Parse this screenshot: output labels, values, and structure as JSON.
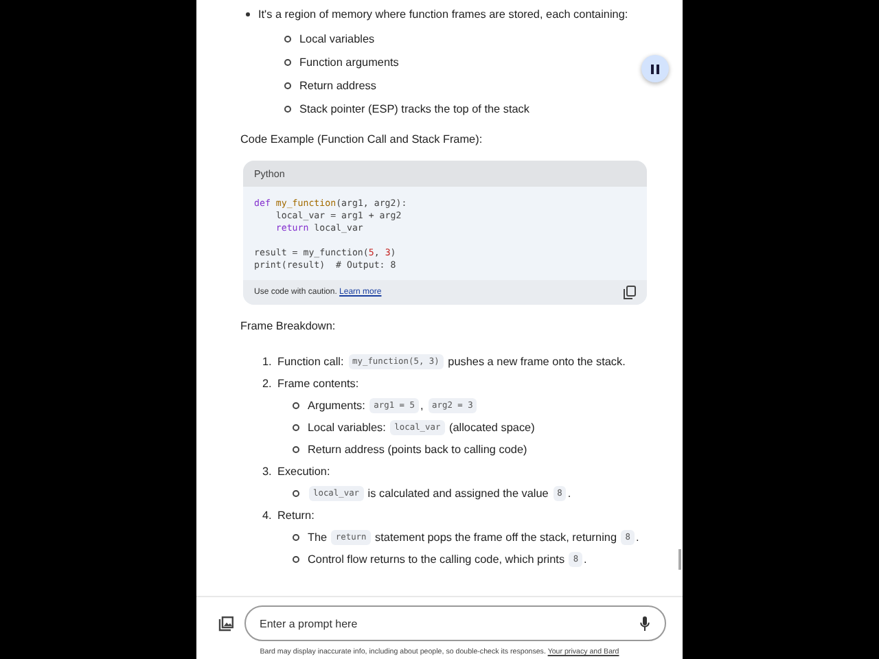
{
  "intro": {
    "text": "It's a region of memory where function frames are stored, each containing:",
    "items": [
      "Local variables",
      "Function arguments",
      "Return address",
      "Stack pointer (ESP) tracks the top of the stack"
    ]
  },
  "code_heading": "Code Example (Function Call and Stack Frame):",
  "code_block": {
    "language": "Python",
    "lines": [
      {
        "kind": "code",
        "tokens": [
          {
            "kind": "keyword",
            "text": "def "
          },
          {
            "kind": "function",
            "text": "my_function"
          },
          {
            "kind": "plain",
            "text": "(arg1, arg2):"
          }
        ]
      },
      {
        "kind": "code",
        "tokens": [
          {
            "kind": "plain",
            "text": "    local_var = arg1 + arg2"
          }
        ]
      },
      {
        "kind": "code",
        "tokens": [
          {
            "kind": "keyword",
            "text": "    return"
          },
          {
            "kind": "plain",
            "text": " local_var"
          }
        ]
      },
      {
        "kind": "blank"
      },
      {
        "kind": "code",
        "tokens": [
          {
            "kind": "plain",
            "text": "result = my_function("
          },
          {
            "kind": "number",
            "text": "5"
          },
          {
            "kind": "plain",
            "text": ", "
          },
          {
            "kind": "number",
            "text": "3"
          },
          {
            "kind": "plain",
            "text": ")"
          }
        ]
      },
      {
        "kind": "code",
        "tokens": [
          {
            "kind": "plain",
            "text": "print(result)  # Output: 8"
          }
        ]
      }
    ],
    "caution": "Use code with caution.",
    "link": "Learn more"
  },
  "breakdown_heading": "Frame Breakdown:",
  "steps": [
    {
      "number": "1.",
      "segments": [
        {
          "kind": "text",
          "text": "Function call: "
        },
        {
          "kind": "code",
          "text": "my_function(5, 3)"
        },
        {
          "kind": "text",
          "text": " pushes a new frame onto the stack."
        }
      ]
    },
    {
      "number": "2.",
      "segments": [
        {
          "kind": "text",
          "text": "Frame contents:"
        }
      ],
      "items": [
        [
          {
            "kind": "text",
            "text": "Arguments: "
          },
          {
            "kind": "code",
            "text": "arg1 = 5"
          },
          {
            "kind": "text",
            "text": ", "
          },
          {
            "kind": "code",
            "text": "arg2 = 3"
          }
        ],
        [
          {
            "kind": "text",
            "text": "Local variables: "
          },
          {
            "kind": "code",
            "text": "local_var"
          },
          {
            "kind": "text",
            "text": " (allocated space)"
          }
        ],
        [
          {
            "kind": "text",
            "text": "Return address (points back to calling code)"
          }
        ]
      ]
    },
    {
      "number": "3.",
      "segments": [
        {
          "kind": "text",
          "text": "Execution:"
        }
      ],
      "items": [
        [
          {
            "kind": "code",
            "text": "local_var"
          },
          {
            "kind": "text",
            "text": " is calculated and assigned the value "
          },
          {
            "kind": "code",
            "text": "8"
          },
          {
            "kind": "text",
            "text": "."
          }
        ]
      ]
    },
    {
      "number": "4.",
      "segments": [
        {
          "kind": "text",
          "text": "Return:"
        }
      ],
      "items": [
        [
          {
            "kind": "text",
            "text": "The "
          },
          {
            "kind": "code",
            "text": "return"
          },
          {
            "kind": "text",
            "text": " statement pops the frame off the stack, returning "
          },
          {
            "kind": "code",
            "text": "8"
          },
          {
            "kind": "text",
            "text": "."
          }
        ],
        [
          {
            "kind": "text",
            "text": "Control flow returns to the calling code, which prints "
          },
          {
            "kind": "code",
            "text": "8"
          },
          {
            "kind": "text",
            "text": "."
          }
        ]
      ]
    }
  ],
  "prompt": {
    "placeholder": "Enter a prompt here"
  },
  "disclaimer": {
    "text": "Bard may display inaccurate info, including about people, so double-check its responses. ",
    "link": "Your privacy and Bard"
  }
}
